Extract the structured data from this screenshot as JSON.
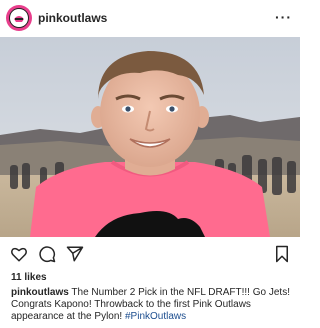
{
  "header": {
    "username": "pinkoutlaws",
    "avatar_icon": "outlaws-logo-icon",
    "more_label": "···"
  },
  "photo": {
    "shirt_color": "#ff6b8f",
    "sky_color": "#cfd6e0"
  },
  "actions": {
    "like_icon": "heart-outline-icon",
    "comment_icon": "comment-bubble-icon",
    "share_icon": "paper-plane-icon",
    "save_icon": "bookmark-icon"
  },
  "likes_text": "11 likes",
  "caption": {
    "user": "pinkoutlaws",
    "text": " The Number 2 Pick in the NFL DRAFT!!! Go Jets! Congrats Kapono! Throwback to the first Pink Outlaws appearance at the Pylon! ",
    "hashtag": "#PinkOutlaws"
  },
  "colors": {
    "accent_link": "#1d4e8f",
    "avatar_ring": "#e83e8c"
  }
}
